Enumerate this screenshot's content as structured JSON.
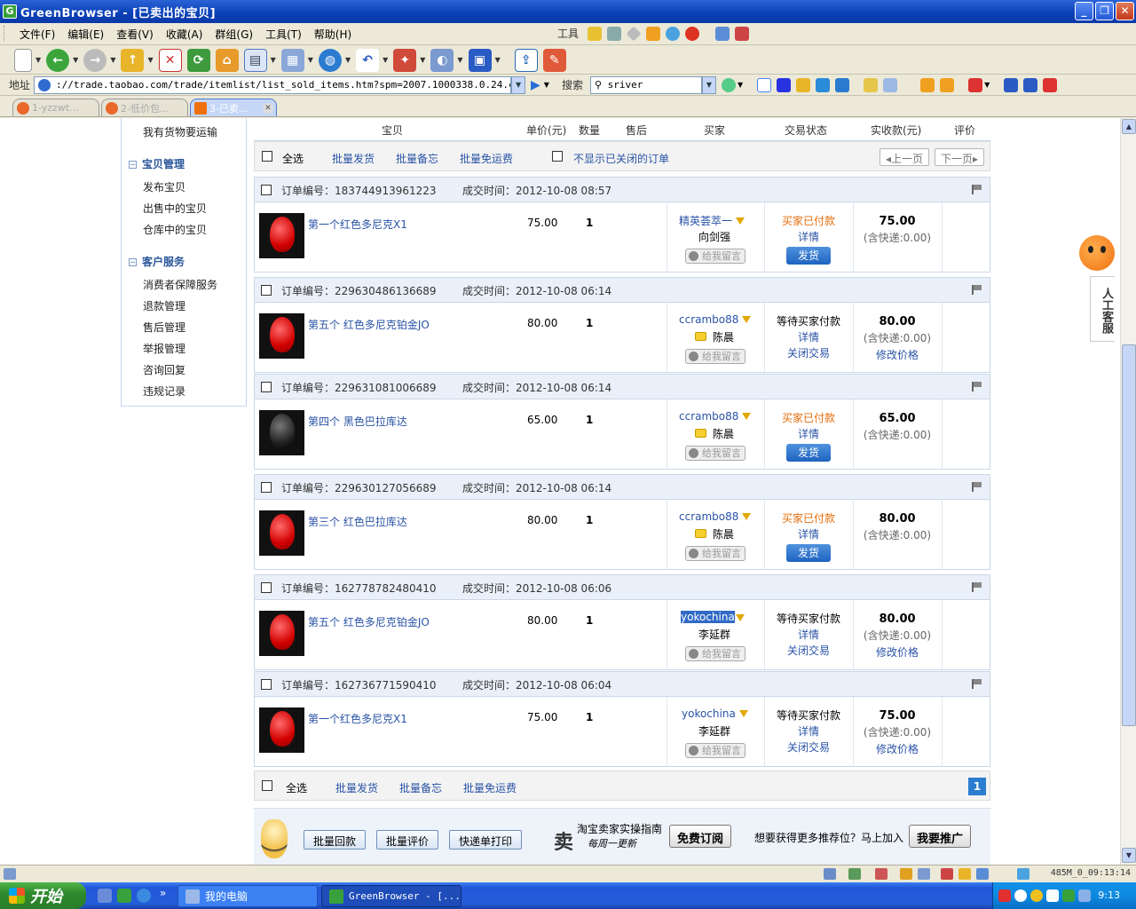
{
  "window": {
    "title": "GreenBrowser - [已卖出的宝贝]",
    "app_icon": "G"
  },
  "menu": [
    "文件(F)",
    "编辑(E)",
    "查看(V)",
    "收藏(A)",
    "群组(G)",
    "工具(T)",
    "帮助(H)"
  ],
  "tools_label": "工具",
  "address": {
    "label": "地址",
    "url": "://trade.taobao.com/trade/itemlist/list_sold_items.htm?spm=2007.1000338.0.24.c553b2",
    "search_label": "搜索",
    "search_value": "sriver"
  },
  "tabs": [
    {
      "label": "1-yzzwt..."
    },
    {
      "label": "2-低价包..."
    },
    {
      "label": "3-已卖..."
    }
  ],
  "sidebar": {
    "top_item": "我有货物要运输",
    "groups": [
      {
        "title": "宝贝管理",
        "items": [
          "发布宝贝",
          "出售中的宝贝",
          "仓库中的宝贝"
        ]
      },
      {
        "title": "客户服务",
        "items": [
          "消费者保障服务",
          "退款管理",
          "售后管理",
          "举报管理",
          "咨询回复",
          "违规记录"
        ]
      }
    ]
  },
  "table_header": {
    "item": "宝贝",
    "price": "单价(元)",
    "qty": "数量",
    "after_sale": "售后",
    "buyer": "买家",
    "status": "交易状态",
    "amount": "实收款(元)",
    "rating": "评价"
  },
  "toolbar_top": {
    "select_all": "全选",
    "batch_ship": "批量发货",
    "batch_memo": "批量备忘",
    "batch_free_ship": "批量免运费",
    "hide_closed": "不显示已关闭的订单",
    "prev_page": "上一页",
    "next_page": "下一页"
  },
  "orders": [
    {
      "order_label": "订单编号：183744913961223",
      "deal_time": "成交时间：2012-10-08 08:57",
      "item_name": "第一个红色多尼克X1",
      "price": "75.00",
      "qty": "1",
      "buyer_nick": "精英荟萃一",
      "buyer_name": "向剑强",
      "leave_msg": "给我留言",
      "status": "买家已付款",
      "detail": "详情",
      "action": "发货",
      "amount": "75.00",
      "shipping": "(含快递:0.00)"
    },
    {
      "order_label": "订单编号：229630486136689",
      "deal_time": "成交时间：2012-10-08 06:14",
      "item_name": "第五个 红色多尼克铂金JO",
      "price": "80.00",
      "qty": "1",
      "buyer_nick": "ccrambo88",
      "buyer_name": "陈晨",
      "leave_msg": "给我留言",
      "status": "等待买家付款",
      "detail": "详情",
      "action": "关闭交易",
      "amount": "80.00",
      "shipping": "(含快递:0.00)",
      "modify": "修改价格"
    },
    {
      "order_label": "订单编号：229631081006689",
      "deal_time": "成交时间：2012-10-08 06:14",
      "item_name": "第四个 黑色巴拉库达",
      "price": "65.00",
      "qty": "1",
      "buyer_nick": "ccrambo88",
      "buyer_name": "陈晨",
      "leave_msg": "给我留言",
      "status": "买家已付款",
      "detail": "详情",
      "action": "发货",
      "amount": "65.00",
      "shipping": "(含快递:0.00)"
    },
    {
      "order_label": "订单编号：229630127056689",
      "deal_time": "成交时间：2012-10-08 06:14",
      "item_name": "第三个 红色巴拉库达",
      "price": "80.00",
      "qty": "1",
      "buyer_nick": "ccrambo88",
      "buyer_name": "陈晨",
      "leave_msg": "给我留言",
      "status": "买家已付款",
      "detail": "详情",
      "action": "发货",
      "amount": "80.00",
      "shipping": "(含快递:0.00)"
    },
    {
      "order_label": "订单编号：162778782480410",
      "deal_time": "成交时间：2012-10-08 06:06",
      "item_name": "第五个 红色多尼克铂金JO",
      "price": "80.00",
      "qty": "1",
      "buyer_nick": "yokochina",
      "buyer_name": "李延群",
      "leave_msg": "给我留言",
      "status": "等待买家付款",
      "detail": "详情",
      "action": "关闭交易",
      "amount": "80.00",
      "shipping": "(含快递:0.00)",
      "modify": "修改价格"
    },
    {
      "order_label": "订单编号：162736771590410",
      "deal_time": "成交时间：2012-10-08 06:04",
      "item_name": "第一个红色多尼克X1",
      "price": "75.00",
      "qty": "1",
      "buyer_nick": "yokochina",
      "buyer_name": "李延群",
      "leave_msg": "给我留言",
      "status": "等待买家付款",
      "detail": "详情",
      "action": "关闭交易",
      "amount": "75.00",
      "shipping": "(含快递:0.00)",
      "modify": "修改价格"
    }
  ],
  "toolbar_bottom": {
    "select_all": "全选",
    "batch_ship": "批量发货",
    "batch_memo": "批量备忘",
    "batch_free_ship": "批量免运费",
    "page": "1"
  },
  "bottom_promo": {
    "batch_refund": "批量回款",
    "batch_rate": "批量评价",
    "express_print": "快递单打印",
    "guide_char": "卖",
    "guide_line1": "淘宝卖家实操指南",
    "guide_line2": "每周一更新",
    "subscribe": "免费订阅",
    "promo_text": "想要获得更多推荐位？马上加入",
    "promote": "我要推广"
  },
  "helper": {
    "label": "人工客服"
  },
  "statusbar": {
    "right_text": "485M_0_09:13:14"
  },
  "taskbar": {
    "start": "开始",
    "tasks": [
      "我的电脑",
      "GreenBrowser - [..."
    ],
    "clock": "9:13"
  },
  "colors": {
    "link": "#2953a6",
    "paid": "#e56c0a",
    "ship_button": "#1e63c0",
    "titlebar": "#0a3fb5"
  }
}
